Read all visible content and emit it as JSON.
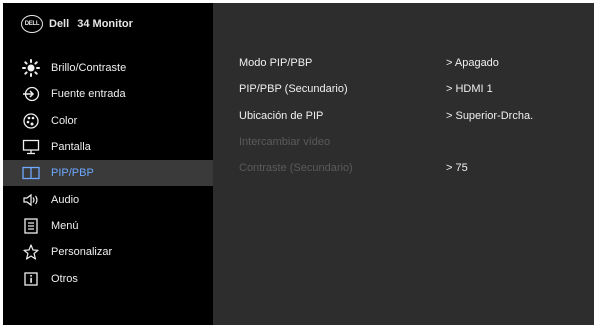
{
  "brand": {
    "logo_text": "DELL",
    "name": "Dell",
    "model": "34 Monitor"
  },
  "sidebar": {
    "items": [
      {
        "label": "Brillo/Contraste",
        "icon": "brightness-icon"
      },
      {
        "label": "Fuente entrada",
        "icon": "input-source-icon"
      },
      {
        "label": "Color",
        "icon": "color-palette-icon"
      },
      {
        "label": "Pantalla",
        "icon": "display-icon"
      },
      {
        "label": "PIP/PBP",
        "icon": "pip-pbp-icon",
        "active": true
      },
      {
        "label": "Audio",
        "icon": "speaker-icon"
      },
      {
        "label": "Menú",
        "icon": "menu-icon"
      },
      {
        "label": "Personalizar",
        "icon": "star-icon"
      },
      {
        "label": "Otros",
        "icon": "info-icon"
      }
    ]
  },
  "settings": [
    {
      "label": "Modo PIP/PBP",
      "value": "> Apagado"
    },
    {
      "label": "PIP/PBP (Secundario)",
      "value": "> HDMI 1"
    },
    {
      "label": "Ubicación de PIP",
      "value": "> Superior-Drcha."
    },
    {
      "label": "Intercambiar vídeo",
      "value": "",
      "disabled": true
    },
    {
      "label": "Contraste (Secundario)",
      "value": "> 75",
      "disabled": true
    }
  ],
  "colors": {
    "active_text": "#6ea8ff",
    "disabled_text": "#5a5a5a",
    "panel_bg": "#2d2d2d",
    "sidebar_bg": "#000000"
  }
}
